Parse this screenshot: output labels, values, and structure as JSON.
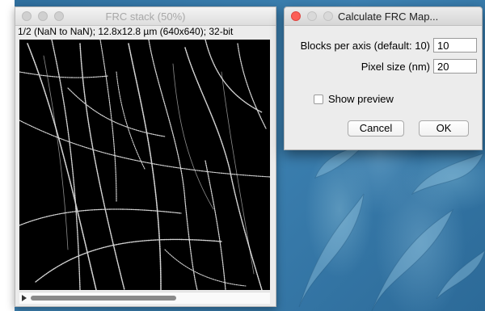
{
  "image_window": {
    "title": "FRC stack (50%)",
    "info": "1/2 (NaN to NaN); 12.8x12.8 µm (640x640); 32-bit",
    "zoom": "50%"
  },
  "dialog": {
    "title": "Calculate FRC Map...",
    "fields": [
      {
        "label": "Blocks per axis (default: 10)",
        "value": "10"
      },
      {
        "label": "Pixel size (nm)",
        "value": "20"
      }
    ],
    "checkbox_label": "Show preview",
    "checkbox_checked": false,
    "cancel_label": "Cancel",
    "ok_label": "OK"
  },
  "colors": {
    "close_button": "#fc5f57",
    "desktop": "#3d82b3"
  }
}
